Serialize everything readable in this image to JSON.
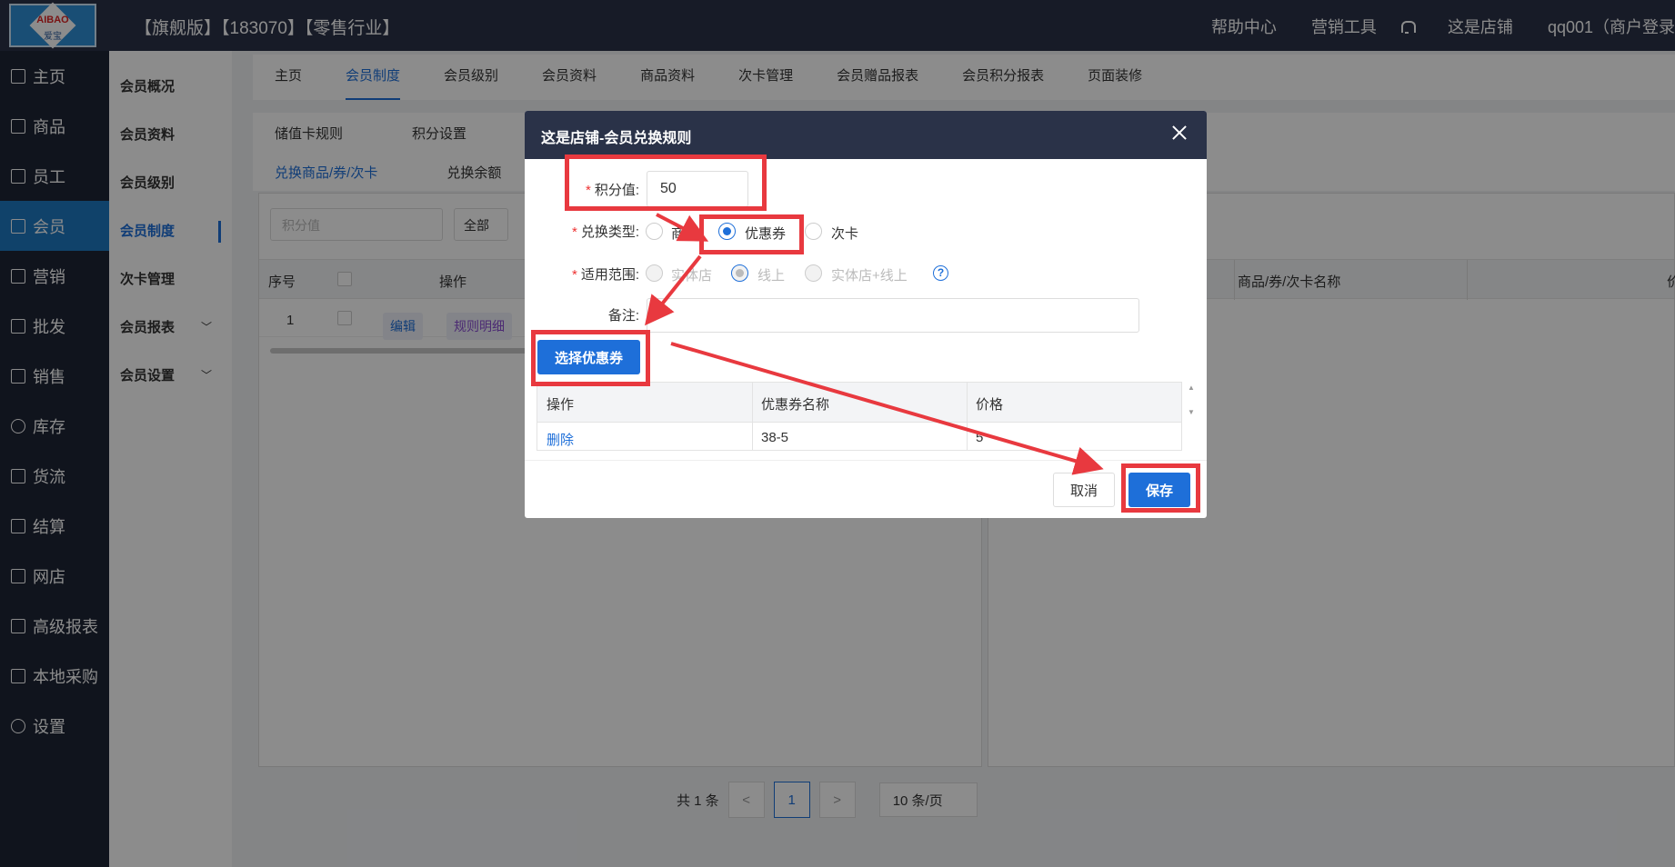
{
  "header": {
    "title": "【旗舰版】【183070】【零售行业】",
    "logo_text": "AIBAO",
    "logo_sub": "爱宝",
    "nav": [
      "帮助中心",
      "营销工具",
      "这是店铺",
      "qq001（商户登录"
    ]
  },
  "sidebar": {
    "items": [
      {
        "label": "主页",
        "icon": "home-icon"
      },
      {
        "label": "商品",
        "icon": "box-icon"
      },
      {
        "label": "员工",
        "icon": "user-icon"
      },
      {
        "label": "会员",
        "icon": "member-icon"
      },
      {
        "label": "营销",
        "icon": "megaphone-icon"
      },
      {
        "label": "批发",
        "icon": "list-icon"
      },
      {
        "label": "销售",
        "icon": "bar-chart-icon"
      },
      {
        "label": "库存",
        "icon": "pie-chart-icon"
      },
      {
        "label": "货流",
        "icon": "cube-icon"
      },
      {
        "label": "结算",
        "icon": "cube-icon"
      },
      {
        "label": "网店",
        "icon": "gift-icon"
      },
      {
        "label": "高级报表",
        "icon": "line-chart-icon"
      },
      {
        "label": "本地采购",
        "icon": "line-chart-icon"
      },
      {
        "label": "设置",
        "icon": "gear-icon"
      }
    ],
    "active_index": 3
  },
  "subsidebar": {
    "items": [
      "会员概况",
      "会员资料",
      "会员级别",
      "会员制度",
      "次卡管理",
      "会员报表",
      "会员设置"
    ],
    "active_index": 3
  },
  "tabs": [
    "主页",
    "会员制度",
    "会员级别",
    "会员资料",
    "商品资料",
    "次卡管理",
    "会员赠品报表",
    "会员积分报表",
    "页面装修"
  ],
  "subtabs": [
    "储值卡规则",
    "积分设置"
  ],
  "subtabs2": [
    "兑换商品/券/次卡",
    "兑换余额"
  ],
  "filter": {
    "placeholder": "积分值",
    "select": "全部"
  },
  "left_table": {
    "headers": [
      "序号",
      "操作"
    ],
    "row": {
      "index": "1",
      "edit": "编辑",
      "detail": "规则明细"
    }
  },
  "right_table": {
    "headers": [
      "商品/券/次卡名称",
      "价"
    ]
  },
  "pager": {
    "total": "共 1 条",
    "prev": "<",
    "page": "1",
    "next": ">",
    "size": "10 条/页"
  },
  "modal": {
    "title": "这是店铺-会员兑换规则",
    "points_label": "积分值:",
    "points_value": "50",
    "type_label": "兑换类型:",
    "type_options": [
      "商品",
      "优惠券",
      "次卡"
    ],
    "type_selected": "优惠券",
    "scope_label": "适用范围:",
    "scope_options": [
      "实体店",
      "线上",
      "实体店+线上"
    ],
    "scope_selected": "线上",
    "help": "?",
    "remark_label": "备注:",
    "remark_value": "",
    "select_coupon_button": "选择优惠券",
    "table_headers": [
      "操作",
      "优惠券名称",
      "价格"
    ],
    "table_row": {
      "action": "删除",
      "name": "38-5",
      "price": "5"
    },
    "cancel_button": "取消",
    "save_button": "保存"
  },
  "colors": {
    "accent": "#1e6fd9",
    "header_bg": "#2a3248",
    "highlight": "#e8393f"
  }
}
